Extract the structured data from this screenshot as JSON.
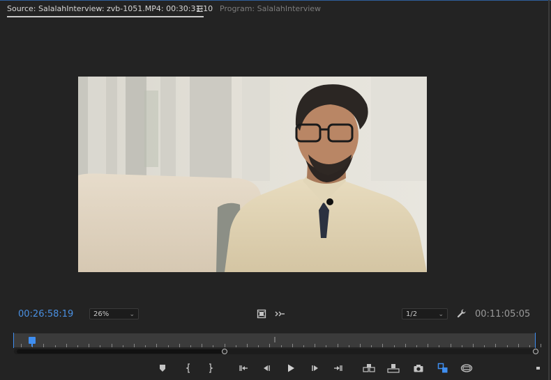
{
  "tabs": {
    "source_label": "Source: SalalahInterview: zvb-1051.MP4: 00:30:31:10",
    "menu_icon": "hamburger-menu-icon",
    "program_label": "Program: SalalahInterview"
  },
  "monitor": {
    "current_timecode": "00:26:58:19",
    "zoom_value": "26%",
    "resolution_value": "1/2",
    "duration_timecode": "00:11:05:05"
  },
  "colors": {
    "accent": "#3f8ef0",
    "timecode_blue": "#4a90e2",
    "panel_bg": "#232323"
  },
  "timeline": {
    "playhead_fraction": 0.035,
    "view_start_fraction": 0.0,
    "view_end_fraction": 0.4
  },
  "icons": {
    "safe_margins": "film-frame-icon",
    "drop_frame": "arrows-icon",
    "settings": "wrench-icon",
    "marker": "marker-icon",
    "mark_in": "mark-in-icon",
    "mark_out": "mark-out-icon",
    "go_to_in": "go-to-in-icon",
    "step_back": "step-back-icon",
    "play": "play-icon",
    "step_forward": "step-forward-icon",
    "go_to_out": "go-to-out-icon",
    "insert": "insert-icon",
    "overwrite": "overwrite-icon",
    "export_frame": "camera-icon",
    "toggle_proxies": "toggle-proxies-icon",
    "vr_video": "vr-headset-icon",
    "more": "more-icon"
  }
}
